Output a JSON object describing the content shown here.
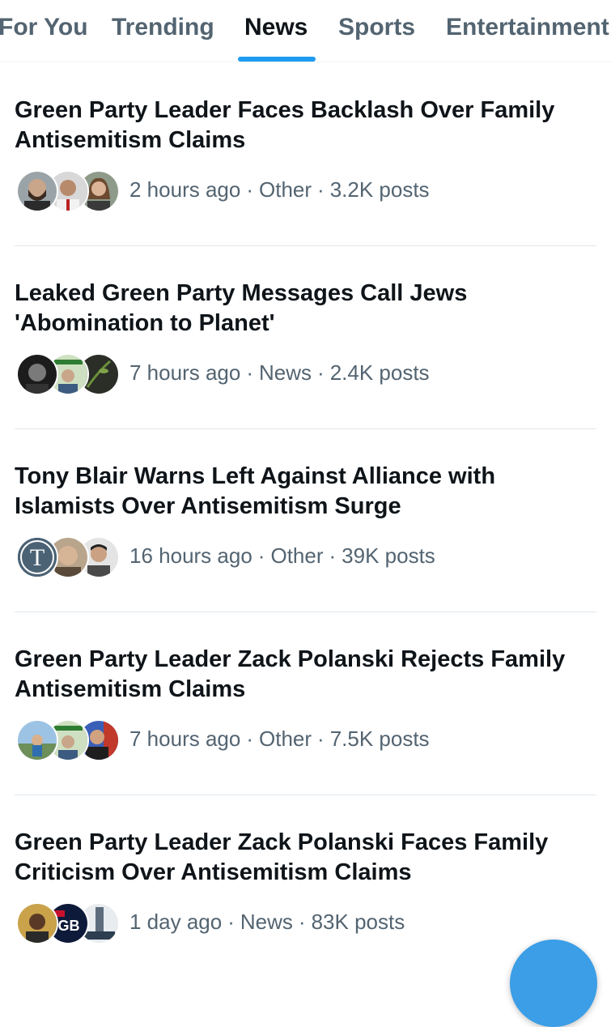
{
  "tabs": [
    {
      "label": "For You",
      "active": false
    },
    {
      "label": "Trending",
      "active": false
    },
    {
      "label": "News",
      "active": true
    },
    {
      "label": "Sports",
      "active": false
    },
    {
      "label": "Entertainment",
      "active": false
    }
  ],
  "stories": [
    {
      "title": "Green Party Leader Faces Backlash Over Family Antisemitism Claims",
      "time": "2 hours ago",
      "category": "Other",
      "posts": "3.2K posts",
      "avatars": [
        "bearded-man-avatar",
        "man-portrait-avatar",
        "woman-portrait-avatar"
      ]
    },
    {
      "title": "Leaked Green Party Messages Call Jews 'Abomination to Planet'",
      "time": "7 hours ago",
      "category": "News",
      "posts": "2.4K posts",
      "avatars": [
        "dark-portrait-avatar",
        "poster-avatar",
        "dark-plant-avatar"
      ]
    },
    {
      "title": "Tony Blair Warns Left Against Alliance with Islamists Over Antisemitism Surge",
      "time": "16 hours ago",
      "category": "Other",
      "posts": "39K posts",
      "avatars": [
        "letter-t-avatar",
        "blurred-face-avatar",
        "man-portrait-avatar"
      ],
      "avatar_letter": "T"
    },
    {
      "title": "Green Party Leader Zack Polanski Rejects Family Antisemitism Claims",
      "time": "7 hours ago",
      "category": "Other",
      "posts": "7.5K posts",
      "avatars": [
        "outdoor-photo-avatar",
        "poster-avatar",
        "suited-man-avatar"
      ]
    },
    {
      "title": "Green Party Leader Zack Polanski Faces Family Criticism Over Antisemitism Claims",
      "time": "1 day ago",
      "category": "News",
      "posts": "83K posts",
      "avatars": [
        "man-gold-background-avatar",
        "gb-news-logo-avatar",
        "newspaper-avatar"
      ],
      "avatar_logo": "GB"
    }
  ],
  "colors": {
    "text": "#0f1419",
    "secondary": "#536471",
    "accent": "#1d9bf0",
    "divider": "#e1e8ed"
  }
}
